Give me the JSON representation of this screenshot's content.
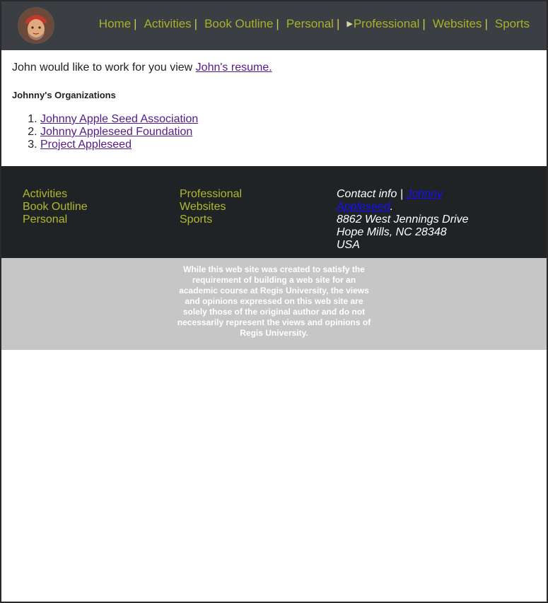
{
  "header": {
    "avatar_alt": "Johnny Appleseed portrait",
    "nav": [
      {
        "label": "Home",
        "sep": "|"
      },
      {
        "label": "Activities",
        "sep": "|"
      },
      {
        "label": "Book Outline",
        "sep": "|"
      },
      {
        "label": "Personal",
        "sep": "|"
      },
      {
        "label": "Professional",
        "sep": "|"
      },
      {
        "label": "Websites",
        "sep": "|"
      },
      {
        "label": "Sports",
        "sep": ""
      }
    ]
  },
  "main": {
    "intro_text": "John would like to work for you view ",
    "resume_link": "John's resume.",
    "org_heading": "Johnny's Organizations",
    "organizations": [
      "Johnny Apple Seed Association",
      "Johnny Appleseed Foundation",
      "Project Appleseed"
    ]
  },
  "footer": {
    "col1": [
      "Activities",
      "Book Outline",
      "Personal"
    ],
    "col2": [
      "Professional",
      "Websites",
      "Sports"
    ],
    "contact_label": "Contact info | ",
    "contact_link": "Johnny Appleseed",
    "contact_link_suffix": ".",
    "address_line1": "8862 West Jennings Drive",
    "address_line2": "Hope Mills, NC 28348",
    "address_line3": "USA"
  },
  "disclaimer": {
    "text": "While this web site was created to satisfy the requirement of building a web site for an academic course at Regis University, the views and opinions expressed on this web site are solely those of the original author and do not necessarily represent the views and opinions of Regis University."
  },
  "colors": {
    "header_bg": "#3b3e42",
    "nav_text": "#a8b12a",
    "footer_bg": "#202326",
    "disclaimer_bg": "#c6c6c6",
    "visited_link": "#551a8b"
  }
}
